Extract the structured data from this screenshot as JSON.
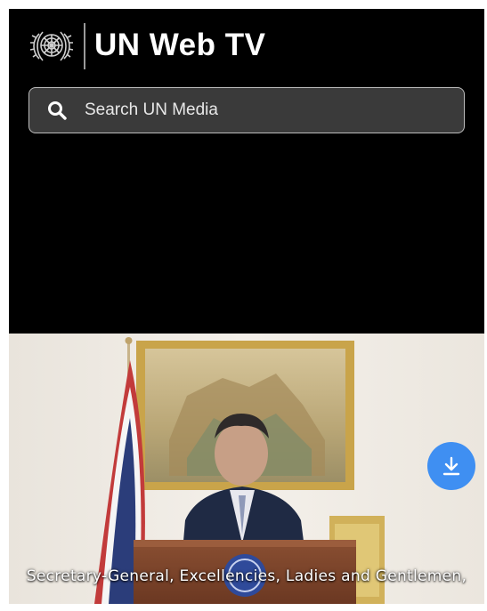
{
  "header": {
    "brand_title": "UN Web TV",
    "logo_icon": "un-emblem-icon"
  },
  "search": {
    "placeholder": "Search UN Media",
    "icon": "search-icon"
  },
  "video": {
    "caption": "Secretary-General, Excellencies, Ladies and Gentlemen,",
    "download_icon": "download-icon",
    "download_button_color": "#3f8ff2"
  },
  "colors": {
    "background": "#000000",
    "search_bg": "#3a3a3a",
    "search_border": "#bdbdbd",
    "text": "#ffffff"
  }
}
